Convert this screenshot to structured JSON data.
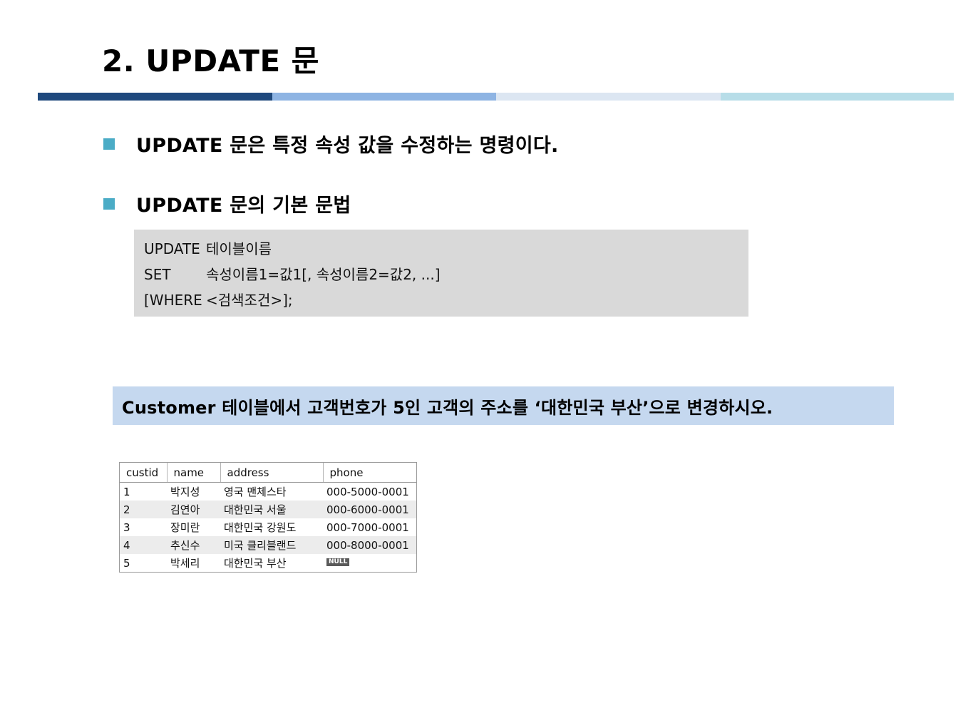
{
  "title": "2. UPDATE 문",
  "divider_colors": [
    "#1f497d",
    "#8eb4e3",
    "#dce6f2",
    "#b7dde8"
  ],
  "bullet_color": "#4bacc6",
  "bullets": [
    "UPDATE 문은 특정 속성 값을 수정하는 명령이다.",
    "UPDATE 문의 기본 문법"
  ],
  "syntax": [
    {
      "keyword": "UPDATE",
      "rest": "테이블이름"
    },
    {
      "keyword": "SET",
      "rest": "속성이름1=값1[, 속성이름2=값2, ...]"
    },
    {
      "keyword": "[WHERE",
      "rest": "<검색조건>];"
    }
  ],
  "question": "Customer 테이블에서 고객번호가 5인 고객의 주소를 ‘대한민국 부산’으로 변경하시오.",
  "result_table": {
    "columns": [
      "custid",
      "name",
      "address",
      "phone"
    ],
    "rows": [
      [
        "1",
        "박지성",
        "영국 맨체스타",
        "000-5000-0001"
      ],
      [
        "2",
        "김연아",
        "대한민국 서울",
        "000-6000-0001"
      ],
      [
        "3",
        "장미란",
        "대한민국 강원도",
        "000-7000-0001"
      ],
      [
        "4",
        "추신수",
        "미국 클리블랜드",
        "000-8000-0001"
      ],
      [
        "5",
        "박세리",
        "대한민국 부산",
        "NULL"
      ]
    ]
  }
}
